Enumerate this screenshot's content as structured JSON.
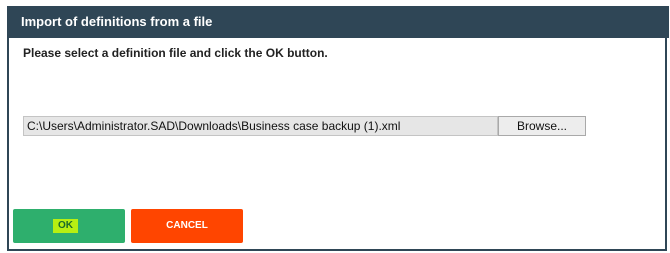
{
  "dialog": {
    "title": "Import of definitions from a file",
    "message": "Please select a definition file and click the OK button.",
    "file_path_value": "C:\\Users\\Administrator.SAD\\Downloads\\Business case backup (1).xml",
    "browse_label": "Browse...",
    "ok_label": "OK",
    "cancel_label": "CANCEL"
  },
  "colors": {
    "titlebar": "#2f4656",
    "ok_button": "#2eaf6d",
    "ok_highlight": "#b7ef12",
    "cancel_button": "#ff4500"
  }
}
